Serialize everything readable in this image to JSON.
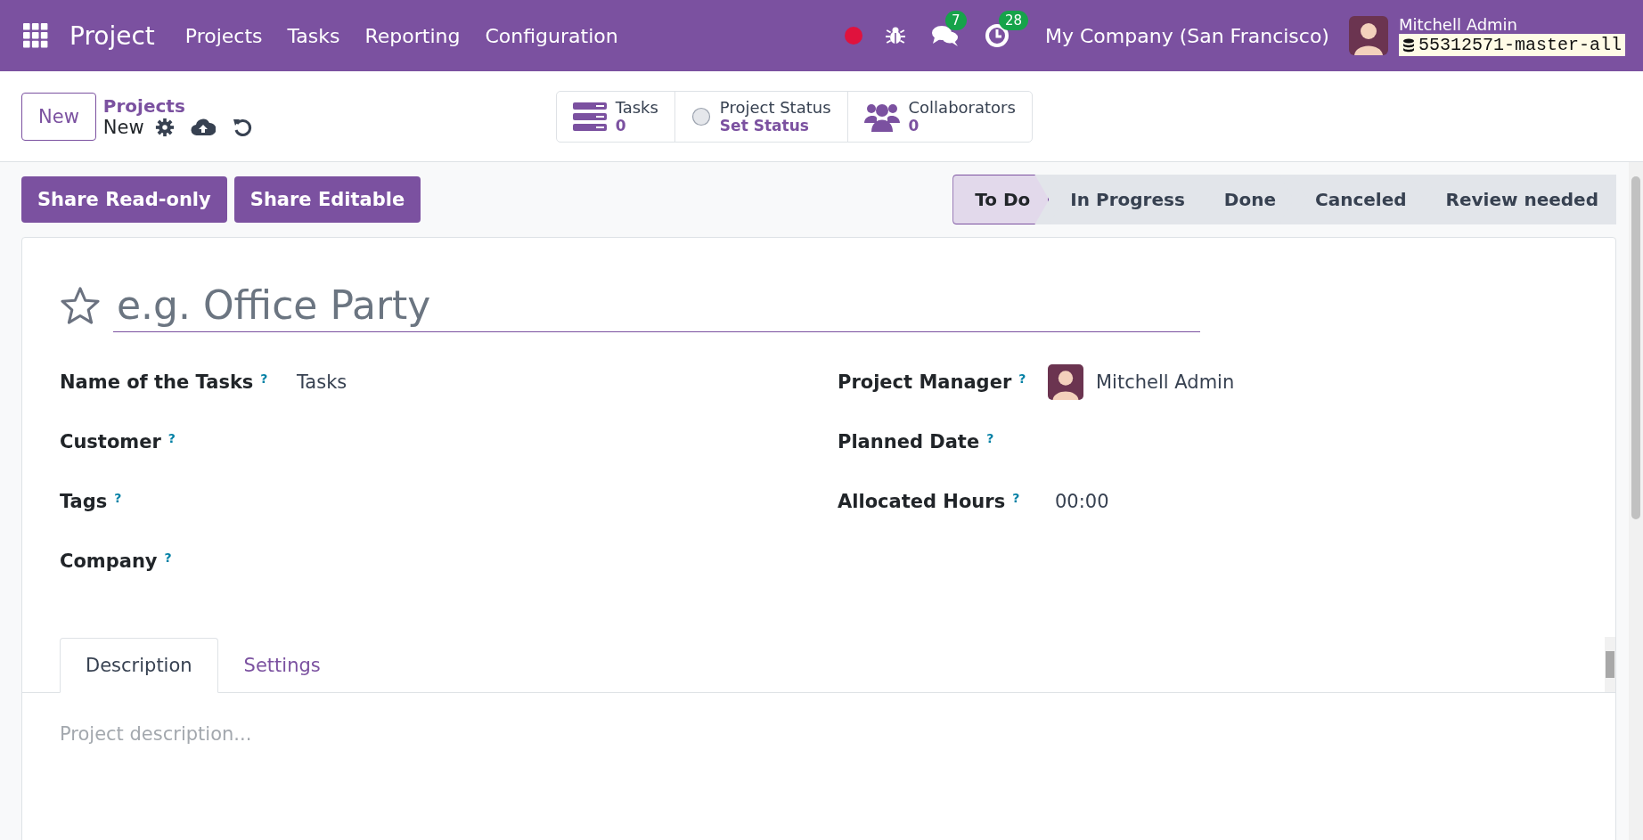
{
  "navbar": {
    "app_name": "Project",
    "menu": [
      "Projects",
      "Tasks",
      "Reporting",
      "Configuration"
    ],
    "messages_count": "7",
    "activities_count": "28",
    "company": "My Company (San Francisco)",
    "user_name": "Mitchell Admin",
    "database": "55312571-master-all"
  },
  "breadcrumb": {
    "parent": "Projects",
    "current": "New"
  },
  "new_button": "New",
  "smart_buttons": [
    {
      "kind": "tasks",
      "label": "Tasks",
      "value": "0"
    },
    {
      "kind": "status",
      "label": "Project Status",
      "value": "Set Status"
    },
    {
      "kind": "collaborators",
      "label": "Collaborators",
      "value": "0"
    }
  ],
  "action_buttons": [
    "Share Read-only",
    "Share Editable"
  ],
  "stages": [
    {
      "label": "To Do",
      "selected": true
    },
    {
      "label": "In Progress",
      "selected": false
    },
    {
      "label": "Done",
      "selected": false
    },
    {
      "label": "Canceled",
      "selected": false
    },
    {
      "label": "Review needed",
      "selected": false
    }
  ],
  "form": {
    "favorite": false,
    "title": {
      "placeholder": "e.g. Office Party"
    },
    "left_fields": [
      {
        "label": "Name of the Tasks",
        "help": "?",
        "value": "Tasks"
      },
      {
        "label": "Customer",
        "help": "?"
      },
      {
        "label": "Tags",
        "help": "?"
      },
      {
        "label": "Company",
        "help": "?"
      }
    ],
    "right_fields": [
      {
        "kind": "user",
        "label": "Project Manager",
        "help": "?",
        "value": "Mitchell Admin"
      },
      {
        "kind": "text",
        "label": "Planned Date",
        "help": "?"
      },
      {
        "kind": "text",
        "label": "Allocated Hours",
        "help": "?",
        "value": "00:00"
      }
    ]
  },
  "tabs": [
    {
      "label": "Description",
      "selected": true
    },
    {
      "label": "Settings",
      "selected": false
    }
  ],
  "description": {
    "placeholder": "Project description..."
  }
}
